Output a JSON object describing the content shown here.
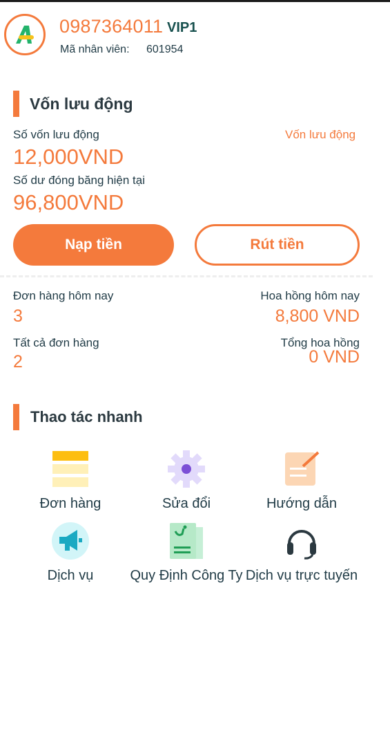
{
  "header": {
    "phone": "0987364011",
    "vip": "VIP1",
    "staff_label": "Mã nhân viên:",
    "staff_id": "601954"
  },
  "capital": {
    "section_title": "Vốn lưu động",
    "capital_label": "Số vốn lưu động",
    "capital_link": "Vốn lưu động",
    "capital_value": "12,000VND",
    "frozen_label": "Số dư đóng băng hiện tại",
    "frozen_value": "96,800VND",
    "deposit_label": "Nạp tiền",
    "withdraw_label": "Rút tiền"
  },
  "stats": {
    "orders_today_label": "Đơn hàng hôm nay",
    "orders_today_value": "3",
    "commission_today_label": "Hoa hồng hôm nay",
    "commission_today_value": "8,800 VND",
    "all_orders_label": "Tất cả đơn hàng",
    "all_orders_value": "2",
    "total_commission_label": "Tổng hoa hồng",
    "total_commission_value": "0 VND"
  },
  "quick": {
    "section_title": "Thao tác nhanh",
    "items": [
      {
        "label": "Đơn hàng",
        "icon": "orders-icon"
      },
      {
        "label": "Sửa đổi",
        "icon": "settings-icon"
      },
      {
        "label": "Hướng dẫn",
        "icon": "guide-icon"
      },
      {
        "label": "Dịch vụ",
        "icon": "megaphone-icon"
      },
      {
        "label": "Quy Định Công Ty",
        "icon": "regulations-icon"
      },
      {
        "label": "Dịch vụ trực tuyến",
        "icon": "headset-icon"
      }
    ]
  },
  "colors": {
    "accent": "#f47a3c",
    "text_dark": "#1f3a45",
    "vip": "#17504e"
  }
}
